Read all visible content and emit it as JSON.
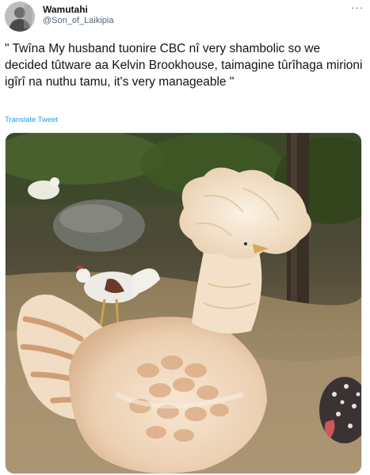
{
  "author": {
    "display_name": "Wamutahi",
    "handle": "@Son_of_Laikipia"
  },
  "tweet": {
    "text": "\" Twîna My husband tuonire CBC nî very shambolic so we decided tûtware aa Kelvin Brookhouse, taimagine tûrîhaga mirioni igîrî na nuthu tamu, it's very manageable \"",
    "translate_label": "Translate Tweet",
    "more_icon": "more-horizontal-icon"
  },
  "media": {
    "subject": "photo-of-crested-chicken-in-yard"
  },
  "colors": {
    "link": "#1d9bf0",
    "secondary_text": "#536471"
  }
}
